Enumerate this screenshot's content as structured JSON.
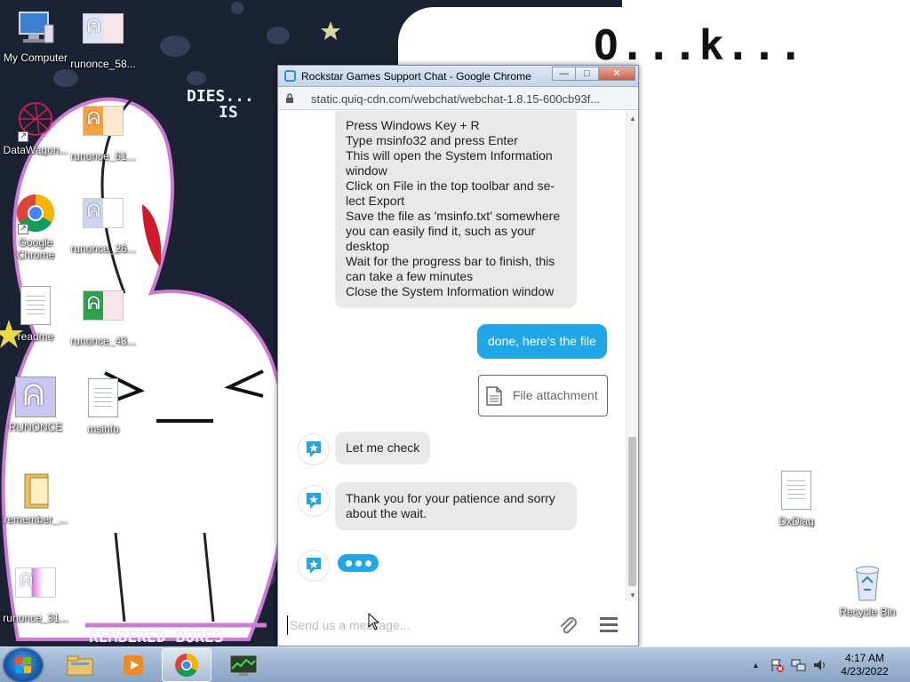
{
  "desktop": {
    "wallpaper_texts": {
      "ok": "O...k...",
      "top_left_a": "DIES...",
      "top_left_b": "IS",
      "bottom": "REMBERED BORES"
    },
    "icons": [
      {
        "label": "My Computer",
        "icon": "computer-icon"
      },
      {
        "label": "runonce_58...",
        "icon": "image-file-icon"
      },
      {
        "label": "DataWagon...",
        "icon": "datawagon-shortcut-icon"
      },
      {
        "label": "runonce_61...",
        "icon": "image-file-icon"
      },
      {
        "label": "Google Chrome",
        "icon": "chrome-icon"
      },
      {
        "label": "runonce_26...",
        "icon": "image-file-icon"
      },
      {
        "label": "readme",
        "icon": "text-file-icon"
      },
      {
        "label": "runonce_43...",
        "icon": "image-file-icon"
      },
      {
        "label": "RUNONCE",
        "icon": "runonce-app-icon"
      },
      {
        "label": "msinfo",
        "icon": "text-file-icon"
      },
      {
        "label": "remember_...",
        "icon": "folder-icon"
      },
      {
        "label": "runonce_31...",
        "icon": "image-file-icon"
      },
      {
        "label": "DxDiag",
        "icon": "text-file-icon"
      },
      {
        "label": "Recycle Bin",
        "icon": "recycle-bin-icon"
      }
    ]
  },
  "window": {
    "title": "Rockstar Games Support Chat - Google Chrome",
    "url": "static.quiq-cdn.com/webchat/webchat-1.8.15-600cb93f...",
    "buttons": {
      "minimize": "—",
      "maximize": "□",
      "close": "✕"
    }
  },
  "chat": {
    "instructions": [
      "Press Windows Key + R",
      "Type msinfo32 and press Enter",
      "This will open the System Information window",
      "Click on File in the top toolbar and se-lect Export",
      "Save the file as 'msinfo.txt' somewhere you can easily find it, such as your desktop",
      "Wait for the progress bar to finish, this can take a few minutes",
      "Close the System Information window"
    ],
    "user_message": "done, here's the file",
    "attachment_label": "File attachment",
    "agent_messages": [
      "Let me check",
      "Thank you for your patience and sorry about the wait."
    ],
    "typing_indicator": "•••",
    "composer_placeholder": "Send us a message..."
  },
  "colors": {
    "accent": "#1fa7e8",
    "agent_bubble": "#e8e8e8",
    "taskbar": "#9fb6d2"
  },
  "taskbar": {
    "apps": [
      {
        "name": "file-explorer-icon"
      },
      {
        "name": "media-player-icon"
      },
      {
        "name": "chrome-icon",
        "active": true
      },
      {
        "name": "task-manager-icon"
      }
    ],
    "tray": {
      "up_arrow": "▲"
    },
    "clock": {
      "time": "4:17 AM",
      "date": "4/23/2022"
    }
  }
}
